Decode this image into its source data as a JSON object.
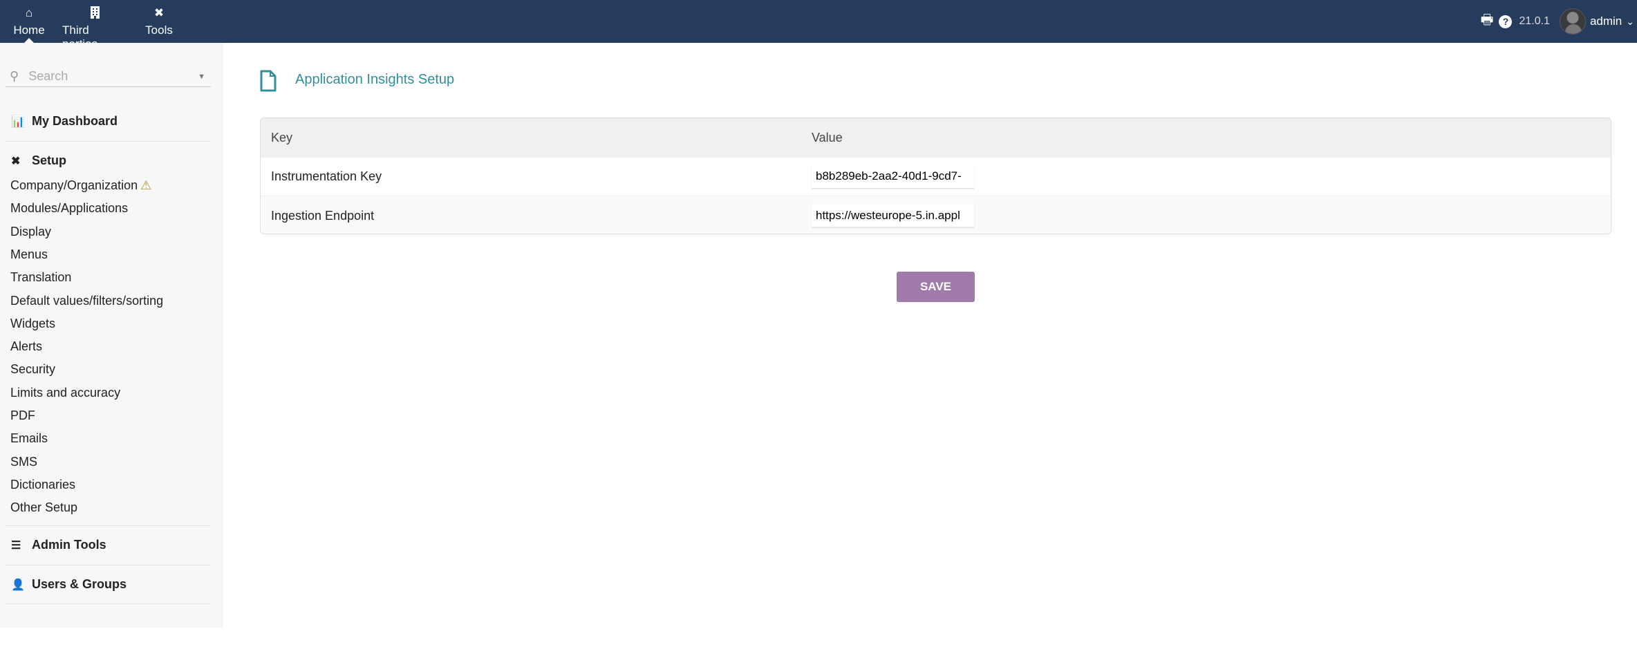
{
  "topnav": {
    "items": [
      {
        "label": "Home",
        "icon": "home-icon"
      },
      {
        "label": "Third parties",
        "icon": "building-icon"
      },
      {
        "label": "Tools",
        "icon": "tools-icon"
      }
    ],
    "version": "21.0.1",
    "user": "admin"
  },
  "sidebar": {
    "search_placeholder": "Search",
    "dashboard": "My Dashboard",
    "setup": "Setup",
    "setup_items": [
      "Company/Organization",
      "Modules/Applications",
      "Display",
      "Menus",
      "Translation",
      "Default values/filters/sorting",
      "Widgets",
      "Alerts",
      "Security",
      "Limits and accuracy",
      "PDF",
      "Emails",
      "SMS",
      "Dictionaries",
      "Other Setup"
    ],
    "admin_tools": "Admin Tools",
    "users_groups": "Users & Groups"
  },
  "main": {
    "title": "Application Insights Setup",
    "table": {
      "headers": [
        "Key",
        "Value"
      ],
      "rows": [
        {
          "key": "Instrumentation Key",
          "value": "b8b289eb-2aa2-40d1-9cd7-"
        },
        {
          "key": "Ingestion Endpoint",
          "value": "https://westeurope-5.in.appl"
        }
      ]
    },
    "save_label": "SAVE"
  },
  "colors": {
    "topbar": "#263c5c",
    "accent": "#2f8f9a",
    "save": "#a07aab",
    "warning": "#b8922a"
  }
}
